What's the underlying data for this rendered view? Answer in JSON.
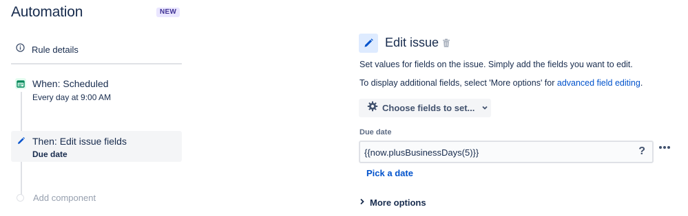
{
  "sidebar": {
    "title": "Automation",
    "badge": "NEW",
    "rule_details": "Rule details",
    "trigger": {
      "title": "When: Scheduled",
      "subtitle": "Every day at 9:00 AM"
    },
    "action": {
      "title": "Then: Edit issue fields",
      "subtitle": "Due date"
    },
    "add_component": "Add component"
  },
  "editor": {
    "title": "Edit issue",
    "description": "Set values for fields on the issue. Simply add the fields you want to edit.",
    "additional_prefix": "To display additional fields, select 'More options' for ",
    "additional_link": "advanced field editing",
    "additional_suffix": ".",
    "choose_fields_label": "Choose fields to set...",
    "field": {
      "label": "Due date",
      "value": "{{now.plusBusinessDays(5)}}",
      "help": "?"
    },
    "pick_date": "Pick a date",
    "more_options": "More options"
  },
  "colors": {
    "accent": "#0052cc",
    "trigger_icon_bg": "#e3fcef",
    "edit_icon_bg": "#deebff",
    "badge_bg": "#eae6ff"
  },
  "icons": {
    "rule_details": "info-icon",
    "trigger": "calendar-icon",
    "action": "pencil-icon",
    "delete": "trash-icon",
    "choose": "gear-icon",
    "more": "ellipsis-icon"
  }
}
